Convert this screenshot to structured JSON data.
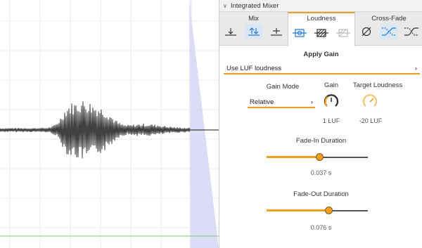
{
  "panel": {
    "title": "Integrated Mixer",
    "tabs": [
      {
        "label": "Mix",
        "icons": [
          "move-down-icon",
          "swap-vertical-icon",
          "add-icon"
        ],
        "selected_icon": 1
      },
      {
        "label": "Loudness",
        "icons": [
          "normalize-icon",
          "hatch-icon",
          "dim-icon"
        ],
        "selected_icon": -1
      },
      {
        "label": "Cross-Fade",
        "icons": [
          "null-icon",
          "crossfade-icon",
          "crossfade-alt-icon"
        ],
        "selected_icon": 1
      }
    ],
    "active_tab": "Loudness",
    "section_title": "Apply Gain",
    "loudness_mode": "Use LUF loudness",
    "gain_mode": {
      "label": "Gain Mode",
      "value": "Relative"
    },
    "gain_knob": {
      "label": "Gain",
      "value": "1 LUF"
    },
    "target_knob": {
      "label": "Target Loudness",
      "value": "-20 LUF"
    },
    "fade_in": {
      "label": "Fade-In Duration",
      "value": "0.037 s",
      "position": 0.52
    },
    "fade_out": {
      "label": "Fade-Out Duration",
      "value": "0.076 s",
      "position": 0.61
    }
  },
  "colors": {
    "accent": "#f0a020",
    "selection": "#1e78d8",
    "fade_overlay": "#cfd0f2",
    "baseline": "#8fd08a"
  }
}
